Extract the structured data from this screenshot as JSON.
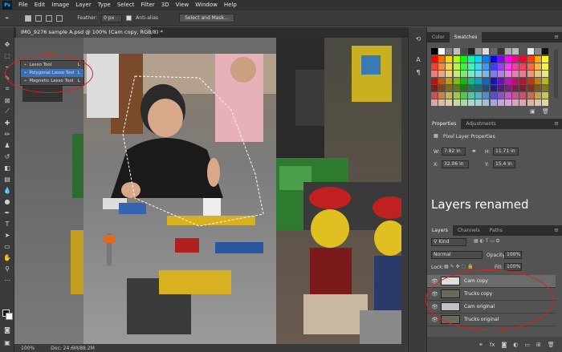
{
  "app": {
    "logo": "Ps"
  },
  "menu": [
    "File",
    "Edit",
    "Image",
    "Layer",
    "Type",
    "Select",
    "Filter",
    "3D",
    "View",
    "Window",
    "Help"
  ],
  "options": {
    "feather_label": "Feather:",
    "feather_value": "0 px",
    "antialias_label": "Anti-alias",
    "select_mask_label": "Select and Mask..."
  },
  "document": {
    "tab_title": "IMG_9276 sample A.psd @ 100% (Cam copy, RGB/8) *",
    "zoom": "100%",
    "doc_size": "Doc: 24.6M/88.2M"
  },
  "lasso_flyout": [
    {
      "label": "Lasso Tool",
      "key": "L",
      "selected": false
    },
    {
      "label": "Polygonal Lasso Tool",
      "key": "L",
      "selected": true
    },
    {
      "label": "Magnetic Lasso Tool",
      "key": "L",
      "selected": false
    }
  ],
  "swatches_panel": {
    "tabs": [
      "Color",
      "Swatches"
    ],
    "active_tab": "Swatches"
  },
  "properties_panel": {
    "tabs": [
      "Properties",
      "Adjustments"
    ],
    "section": "Pixel Layer Properties",
    "w_label": "W:",
    "w_value": "7.82 in",
    "h_label": "H:",
    "h_value": "11.71 in",
    "x_label": "X:",
    "x_value": "32.06 in",
    "y_label": "Y:",
    "y_value": "15.4 in"
  },
  "annotation_text": "Layers renamed",
  "layers_panel": {
    "tabs": [
      "Layers",
      "Channels",
      "Paths"
    ],
    "filter_label": "Kind",
    "blend_mode": "Normal",
    "opacity_label": "Opacity:",
    "opacity_value": "100%",
    "lock_label": "Lock:",
    "fill_label": "Fill:",
    "fill_value": "100%",
    "layers": [
      {
        "name": "Cam copy",
        "selected": true
      },
      {
        "name": "Trucks copy",
        "selected": false
      },
      {
        "name": "Cam original",
        "selected": false
      },
      {
        "name": "Trucks original",
        "selected": false
      }
    ]
  },
  "colors": {
    "menubar": "#323232",
    "panel": "#535353",
    "highlight": "#3b6fb6",
    "annotation_red": "#d9231e"
  }
}
